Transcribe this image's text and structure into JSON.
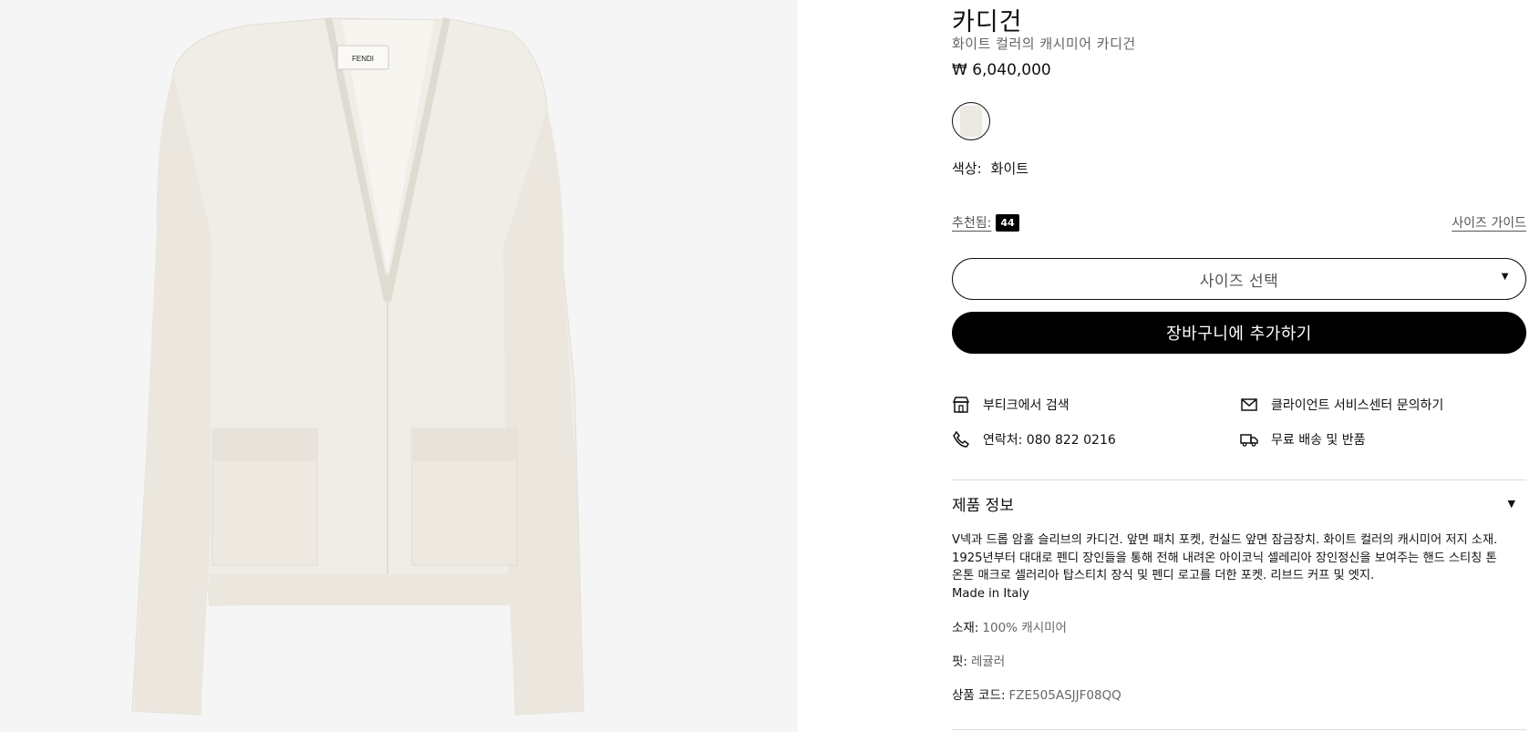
{
  "product": {
    "title": "카디건",
    "subtitle": "화이트 컬러의 캐시미어 카디건",
    "price": "₩ 6,040,000",
    "color_label": "색상:",
    "color_value": "화이트",
    "swatch_color": "#ece9e2",
    "image_label": "FENDI"
  },
  "size": {
    "recommended_label": "추천됨:",
    "recommended_count": "44",
    "guide_label": "사이즈 가이드",
    "select_placeholder": "사이즈 선택"
  },
  "actions": {
    "add_to_cart": "장바구니에 추가하기"
  },
  "services": [
    {
      "icon": "store-icon",
      "label": "부티크에서 검색"
    },
    {
      "icon": "mail-icon",
      "label": "클라이언트 서비스센터 문의하기"
    },
    {
      "icon": "phone-icon",
      "label": "연락처: 080 822 0216"
    },
    {
      "icon": "delivery-icon",
      "label": "무료 배송 및 반품"
    }
  ],
  "product_info": {
    "header": "제품 정보",
    "description_lines": [
      "V넥과 드롭 암홀 슬리브의 카디건. 앞면 패치 포켓, 컨실드 앞면 잠금장치. 화이트 컬러의 캐시미어 저지 소재.",
      "1925년부터 대대로 펜디 장인들을 통해 전해 내려온 아이코닉 셀레리아 장인정신을 보여주는 핸드 스티칭 톤",
      "온톤 매크로 셀러리아 탑스티치 장식 및 펜디 로고를 더한 포켓. 리브드 커프 및 엣지."
    ],
    "made_in": "Made in Italy",
    "material_label": "소재:",
    "material_value": "100% 캐시미어",
    "fit_label": "핏:",
    "fit_value": "레귤러",
    "code_label": "상품 코드:",
    "code_value": "FZE505ASJJF08QQ"
  }
}
